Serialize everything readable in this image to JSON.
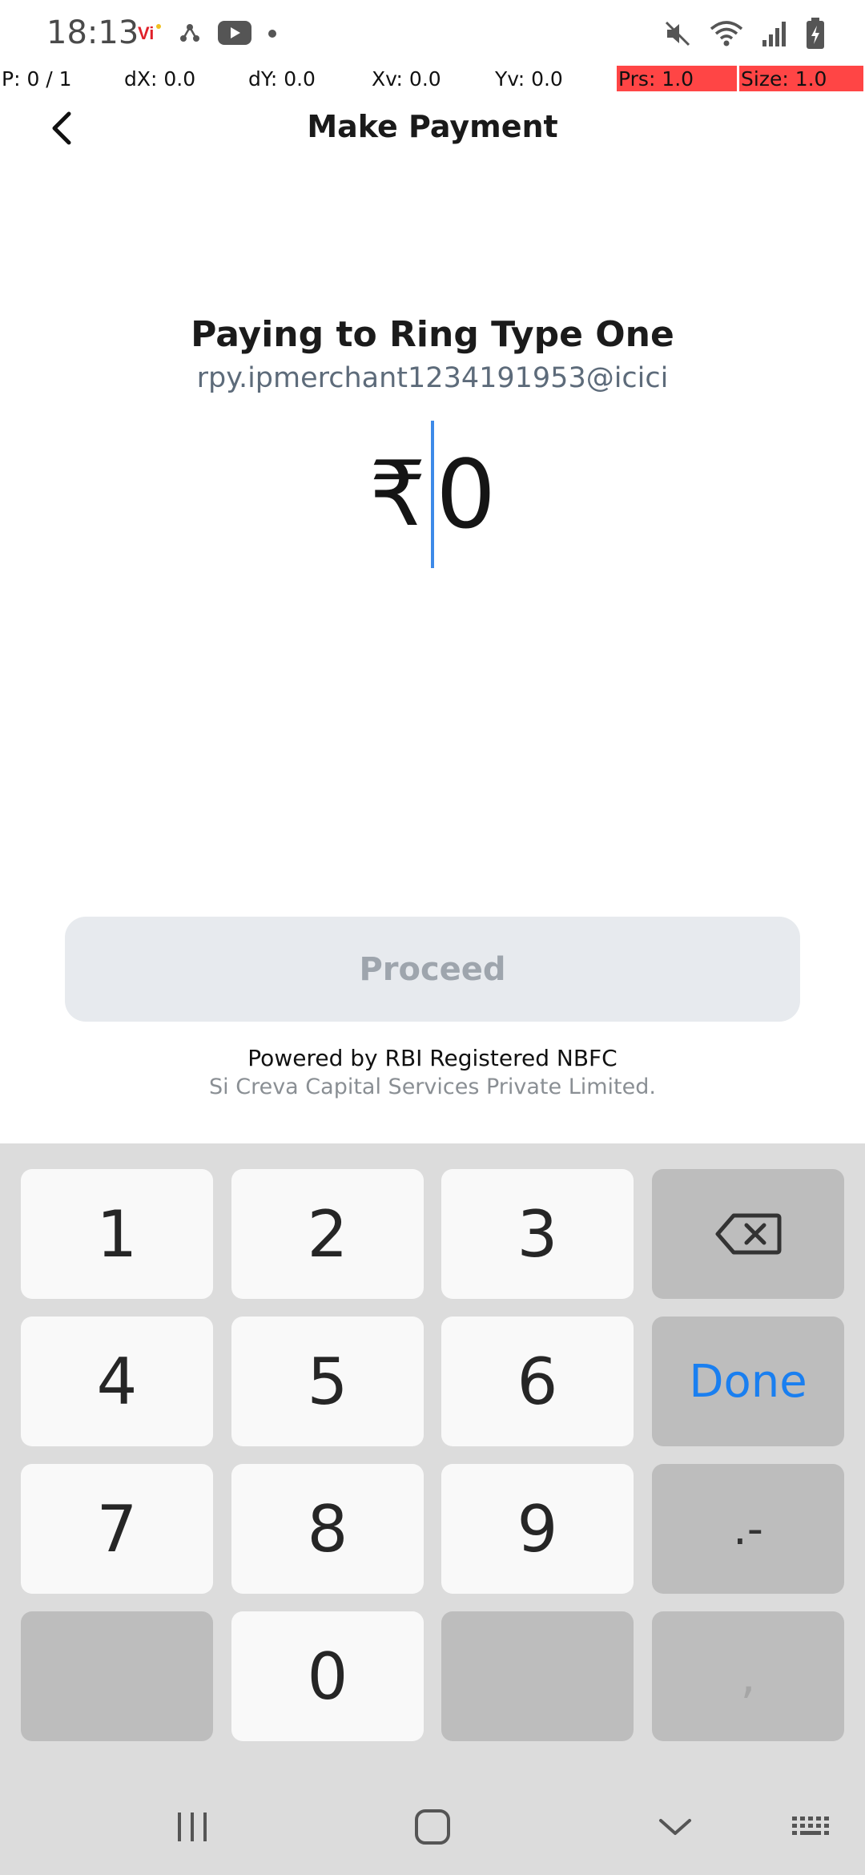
{
  "status_bar": {
    "time": "18:13"
  },
  "pointer_overlay": {
    "p": "P: 0 / 1",
    "dx": "dX: 0.0",
    "dy": "dY: 0.0",
    "xv": "Xv: 0.0",
    "yv": "Yv: 0.0",
    "prs": "Prs: 1.0",
    "size": "Size: 1.0"
  },
  "header": {
    "title": "Make Payment",
    "back_icon": "chevron-left-icon"
  },
  "payee": {
    "name": "Paying to Ring Type One",
    "upi_id": "rpy.ipmerchant1234191953@icici"
  },
  "amount": {
    "currency_symbol": "₹",
    "value": "0"
  },
  "proceed": {
    "label": "Proceed",
    "enabled": false
  },
  "footer": {
    "powered_by": "Powered by RBI Registered NBFC",
    "company": "Si Creva Capital Services Private Limited."
  },
  "keyboard": {
    "keys": [
      "1",
      "2",
      "3",
      "4",
      "5",
      "6",
      "7",
      "8",
      "9",
      "0"
    ],
    "done_label": "Done",
    "dot_dash_label": ".-",
    "comma_label": ",",
    "backspace_icon": "backspace-icon",
    "accent_color": "#1a7ff0"
  },
  "nav_bar": {
    "recents_icon": "recents-icon",
    "home_icon": "home-icon",
    "back_icon": "hide-keyboard-chevron-icon",
    "keyboard_icon": "keyboard-icon"
  },
  "colors": {
    "caret": "#3d8ae8",
    "proceed_disabled_bg": "#e7eaee",
    "overlay_highlight": "#ff4545"
  }
}
